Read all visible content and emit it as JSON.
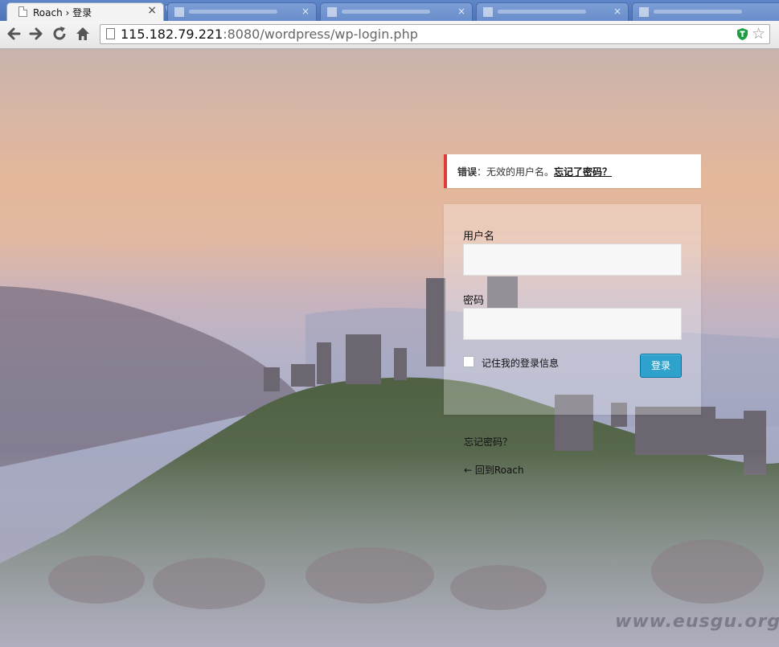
{
  "browser": {
    "active_tab_title": "Roach › 登录",
    "active_tab_close": "×",
    "url_host": "115.182.79.221",
    "url_rest": ":8080/wordpress/wp-login.php"
  },
  "error": {
    "label": "错误",
    "separator": "：",
    "message": "无效的用户名。",
    "link": "忘记了密码？"
  },
  "form": {
    "username_label": "用户名",
    "username_value": "",
    "password_label": "密码",
    "password_value": "",
    "remember_label": "记住我的登录信息",
    "remember_checked": false,
    "submit_label": "登录"
  },
  "links": {
    "lost_password": "忘记密码？",
    "back_to_blog": "← 回到Roach"
  },
  "watermark": "www.eusgu.org",
  "colors": {
    "error_accent": "#dd3d36",
    "button": "#2ea2cc",
    "button_border": "#0074a2"
  }
}
